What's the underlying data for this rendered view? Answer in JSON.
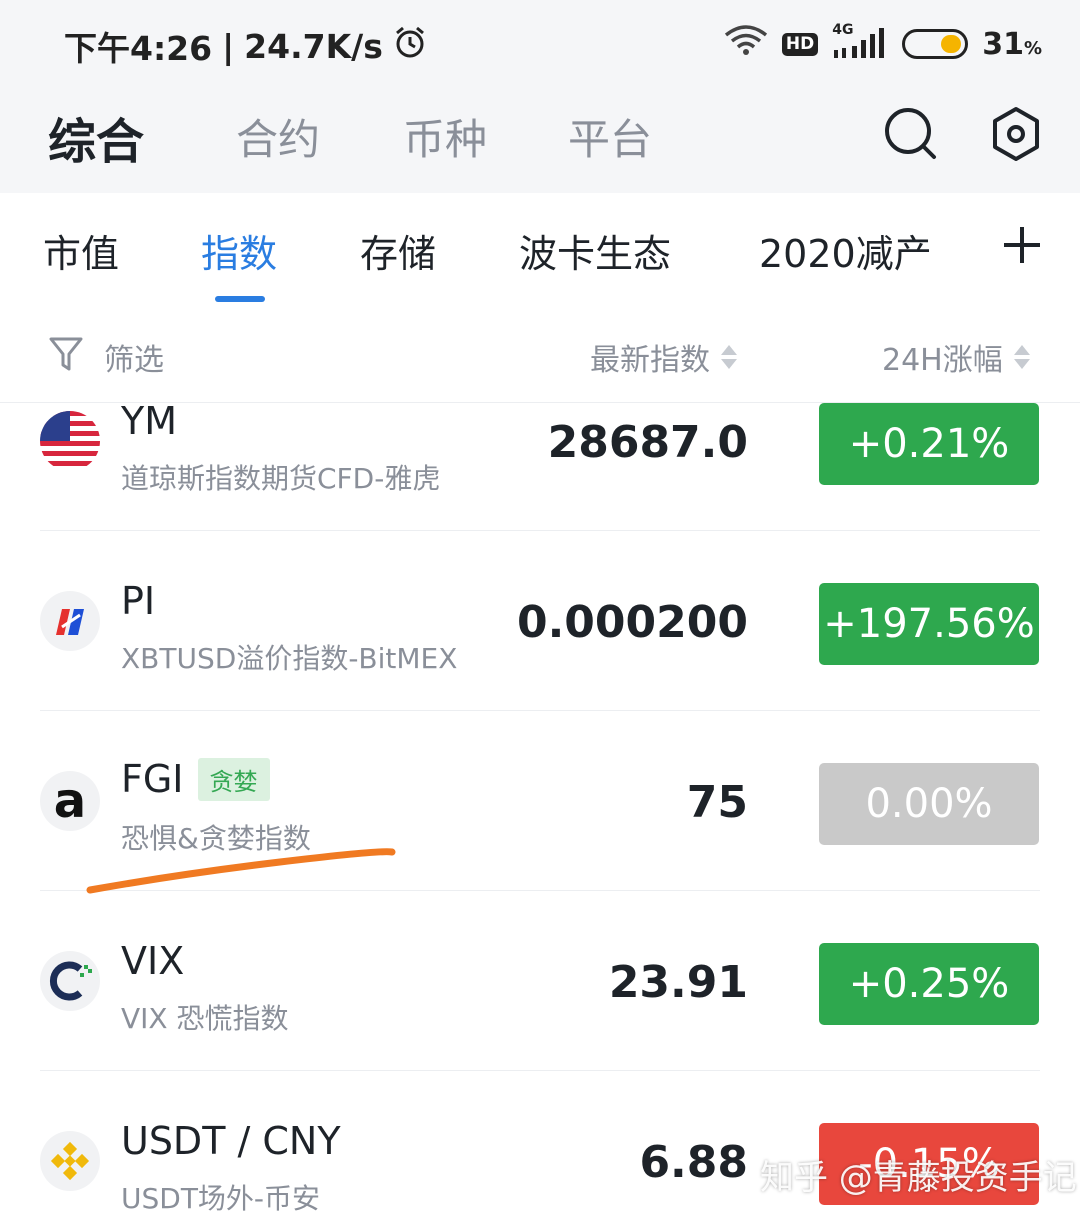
{
  "status_bar": {
    "time": "下午4:26",
    "net_speed": "24.7K/s",
    "alarm_icon": "alarm-clock-icon",
    "hd_label": "HD",
    "network_label": "4G",
    "battery_pct": "31",
    "battery_unit": "%",
    "battery_color": "#f5b400"
  },
  "top_nav": {
    "tabs": [
      {
        "label": "综合",
        "active": true
      },
      {
        "label": "合约",
        "active": false
      },
      {
        "label": "币种",
        "active": false
      },
      {
        "label": "平台",
        "active": false
      }
    ],
    "search_icon": "search-icon",
    "settings_icon": "hexagon-settings-icon"
  },
  "category_tabs": {
    "tabs": [
      {
        "label": "市值",
        "active": false
      },
      {
        "label": "指数",
        "active": true
      },
      {
        "label": "存储",
        "active": false
      },
      {
        "label": "波卡生态",
        "active": false
      },
      {
        "label": "2020减产",
        "active": false
      }
    ],
    "add_icon": "plus-icon",
    "accent_color": "#2a7de1"
  },
  "filter_row": {
    "filter_label": "筛选",
    "col_price": "最新指数",
    "col_change": "24H涨幅"
  },
  "rows": [
    {
      "symbol": "YM",
      "tag": "",
      "desc": "道琼斯指数期货CFD-雅虎",
      "price": "28687.0",
      "change": "+0.21%",
      "change_color": "#2ea84e",
      "logo": "us-flag-icon"
    },
    {
      "symbol": "PI",
      "tag": "",
      "desc": "XBTUSD溢价指数-BitMEX",
      "price": "0.000200",
      "change": "+197.56%",
      "change_color": "#2ea84e",
      "logo": "bitmex-logo-icon"
    },
    {
      "symbol": "FGI",
      "tag": "贪婪",
      "desc": "恐惧&贪婪指数",
      "price": "75",
      "change": "0.00%",
      "change_color": "#c9c9c9",
      "logo": "alternative-me-logo-icon"
    },
    {
      "symbol": "VIX",
      "tag": "",
      "desc": "VIX 恐慌指数",
      "price": "23.91",
      "change": "+0.25%",
      "change_color": "#2ea84e",
      "logo": "cboe-logo-icon"
    },
    {
      "symbol": "USDT / CNY",
      "tag": "",
      "desc": "USDT场外-币安",
      "price": "6.88",
      "change": "-0.15%",
      "change_color": "#e8473d",
      "logo": "binance-logo-icon"
    }
  ],
  "watermark": "知乎 @青藤投资手记",
  "annotation_color": "#f07a22"
}
